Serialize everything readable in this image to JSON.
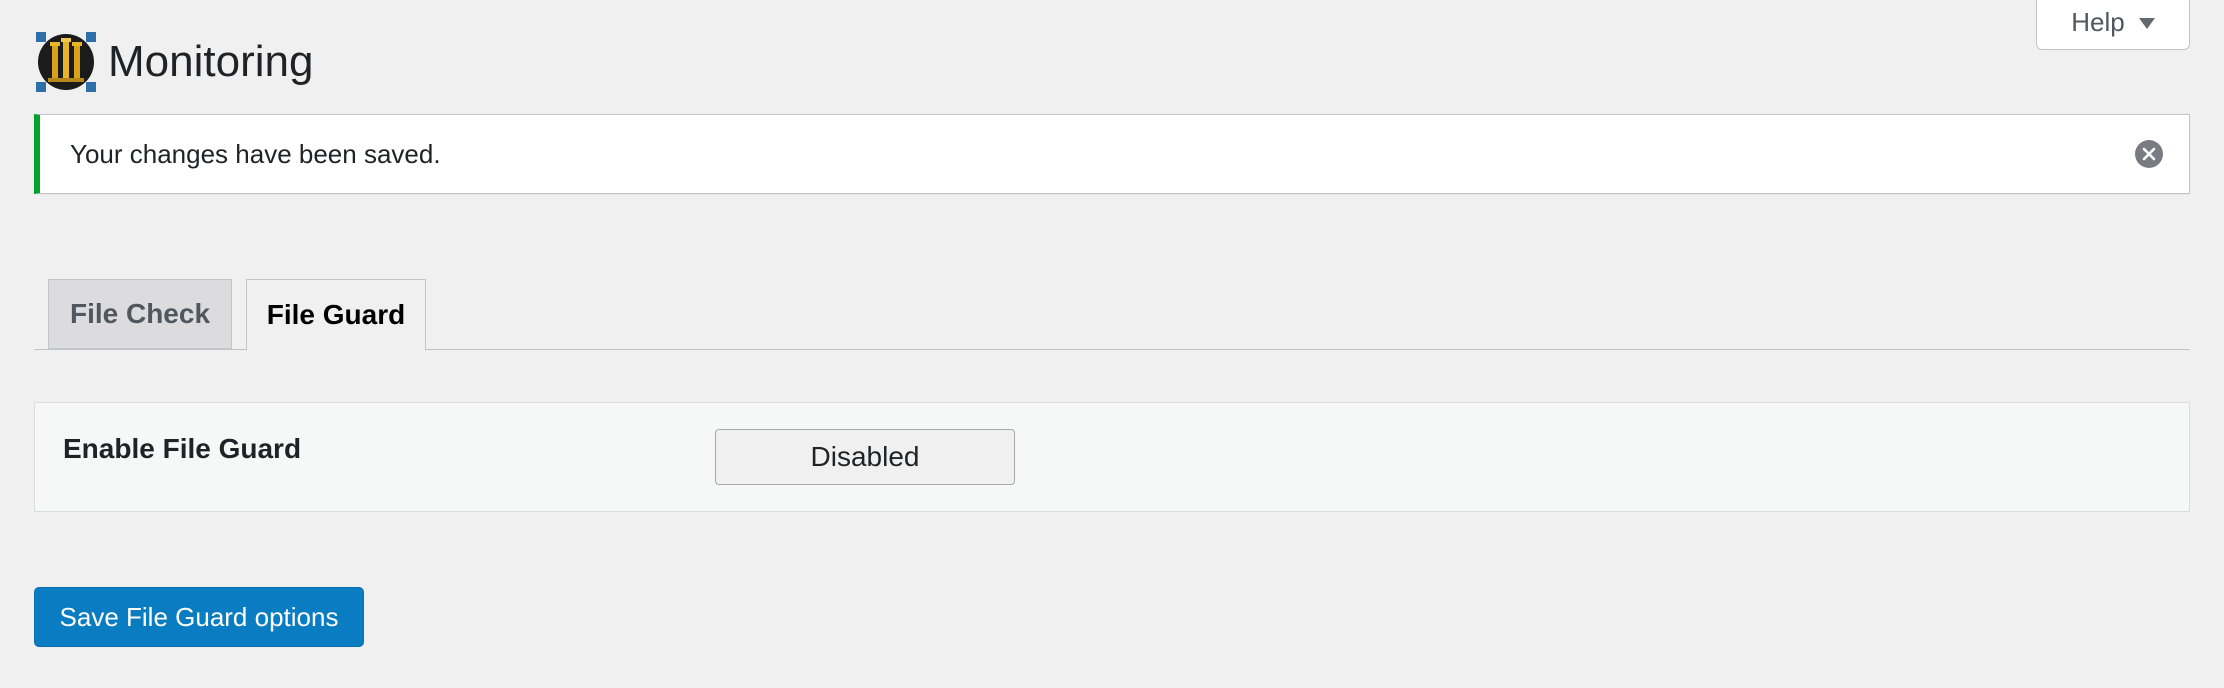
{
  "help": {
    "label": "Help"
  },
  "header": {
    "title": "Monitoring"
  },
  "notice": {
    "message": "Your changes have been saved."
  },
  "tabs": [
    {
      "label": "File Check",
      "active": false
    },
    {
      "label": "File Guard",
      "active": true
    }
  ],
  "settings": {
    "enable_file_guard": {
      "label": "Enable File Guard",
      "button_label": "Disabled"
    }
  },
  "actions": {
    "save_label": "Save File Guard options"
  },
  "colors": {
    "accent": "#0a7cc2",
    "success": "#00a32a",
    "background": "#f0f0f1"
  },
  "icons": {
    "logo": "castle-tower-logo-icon",
    "dismiss": "close-circle-icon",
    "help_caret": "caret-down-icon"
  }
}
